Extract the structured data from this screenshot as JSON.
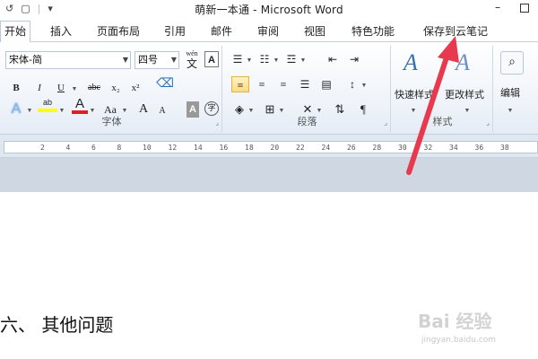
{
  "titlebar": {
    "title": "萌新一本通  -  Microsoft Word",
    "qat_undo": "↺",
    "qat_doc": "▢",
    "qat_more": "▾",
    "minimize": "–"
  },
  "tabs": [
    {
      "label": "开始"
    },
    {
      "label": "插入"
    },
    {
      "label": "页面布局"
    },
    {
      "label": "引用"
    },
    {
      "label": "邮件"
    },
    {
      "label": "审阅"
    },
    {
      "label": "视图"
    },
    {
      "label": "特色功能"
    },
    {
      "label": "保存到云笔记"
    }
  ],
  "ribbon": {
    "font_name": "宋体-简",
    "font_size": "四号",
    "font_group_label": "字体",
    "paragraph_group_label": "段落",
    "styles_group_label": "样式",
    "quick_styles_label": "快速样式",
    "change_styles_label": "更改样式",
    "editing_label": "编辑",
    "bold": "B",
    "italic": "I",
    "underline": "U",
    "strike": "abc",
    "subscript": "x₂",
    "superscript": "x²",
    "aa": "Aa",
    "grow": "A",
    "shrink": "A",
    "wen": "wén",
    "wen_char": "文",
    "font_a": "A",
    "circle_char": "字"
  },
  "ruler": {
    "marks": [
      "2",
      "4",
      "6",
      "8",
      "10",
      "12",
      "14",
      "16",
      "18",
      "20",
      "22",
      "24",
      "26",
      "28",
      "30",
      "32",
      "34",
      "36",
      "38"
    ]
  },
  "document": {
    "heading": "六、  其他问题"
  },
  "watermark": {
    "brand": "Bai 经验",
    "url": "jingyan.baidu.com"
  },
  "colors": {
    "accent_arrow": "#e83a4f",
    "ribbon_border": "#c5d1e0",
    "highlight_yellow": "#ffff00",
    "font_red": "#e02020"
  }
}
